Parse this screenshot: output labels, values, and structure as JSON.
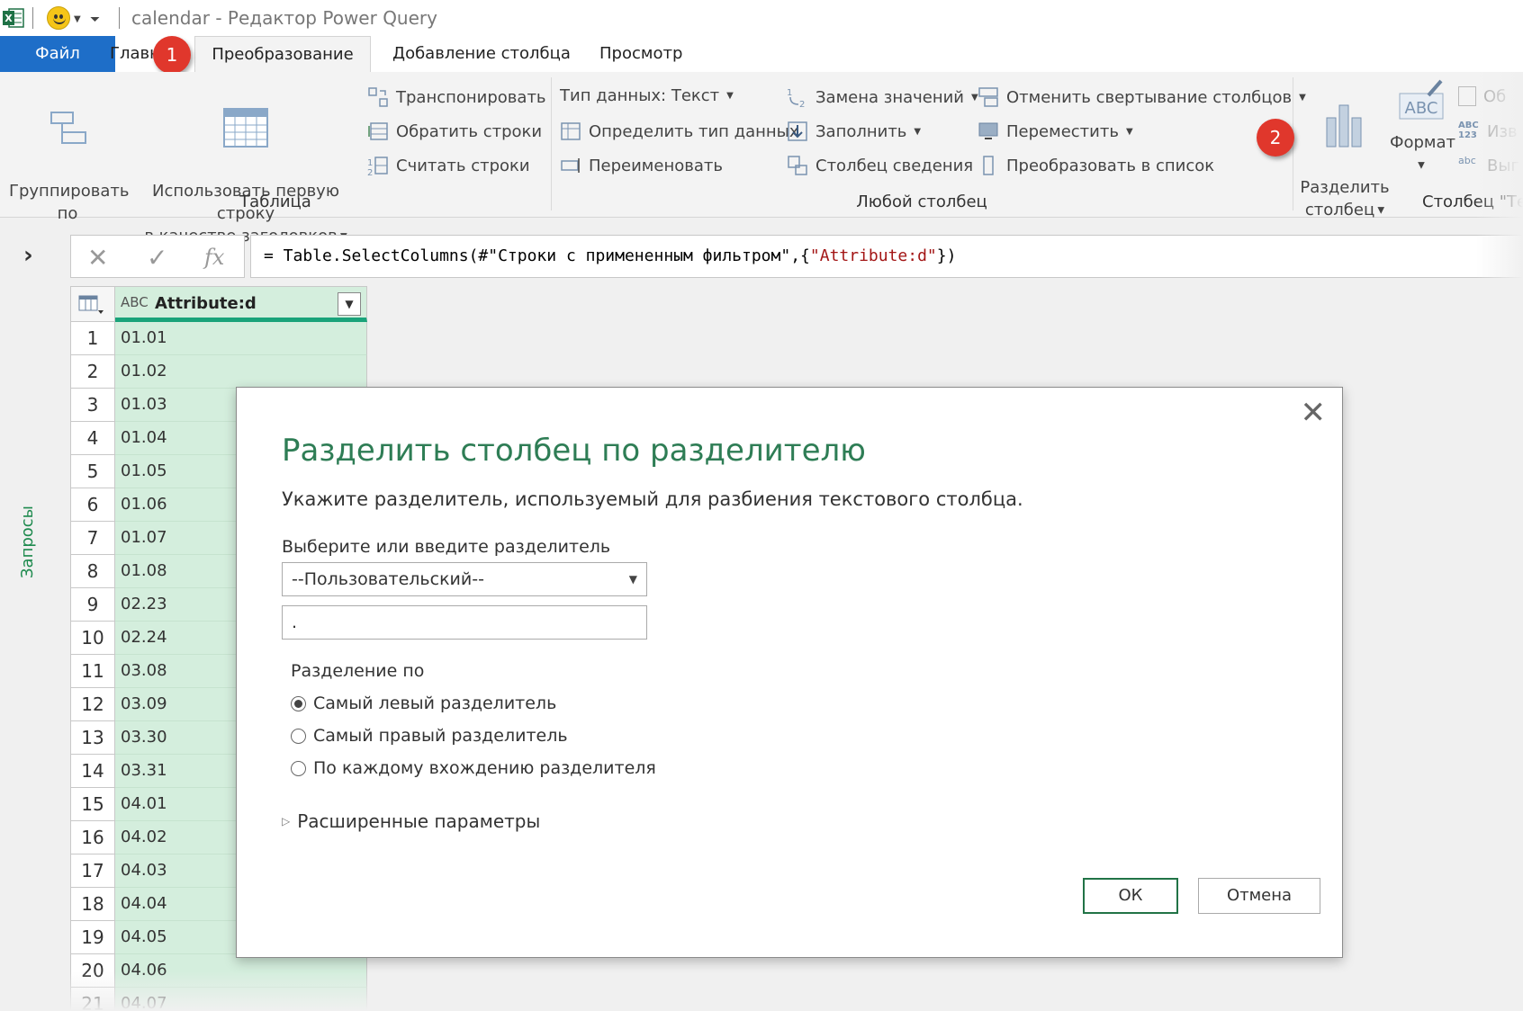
{
  "window": {
    "title": "calendar - Редактор Power Query"
  },
  "tabs": [
    {
      "label": "Файл"
    },
    {
      "label": "Главн"
    },
    {
      "label": "Преобразование"
    },
    {
      "label": "Добавление столбца"
    },
    {
      "label": "Просмотр"
    }
  ],
  "badges": [
    "1",
    "2"
  ],
  "ribbon": {
    "group_by": "Группировать\nпо",
    "use_first_row": "Использовать первую строку\nв качестве заголовков",
    "transpose": "Транспонировать",
    "reverse_rows": "Обратить строки",
    "count_rows": "Считать строки",
    "data_type": "Тип данных: Текст",
    "detect_type": "Определить тип данных",
    "rename": "Переименовать",
    "replace_values": "Замена значений",
    "fill": "Заполнить",
    "pivot": "Столбец сведения",
    "unpivot": "Отменить свертывание столбцов",
    "move": "Переместить",
    "to_list": "Преобразовать в список",
    "split_column": "Разделить\nстолбец",
    "format": "Формат",
    "merge_partial": "Об",
    "extract_partial": "Изв",
    "parse_partial": "Выг",
    "groups": {
      "table": "Таблица",
      "any_column": "Любой столбец",
      "text_column": "Столбец \"Те"
    }
  },
  "queries_pane": {
    "label": "Запросы"
  },
  "formula": {
    "prefix": "= Table.SelectColumns(#",
    "source": "\"Строки с примененным фильтром\"",
    "mid": ",{",
    "column": "\"Attribute:d\"",
    "suffix": "})"
  },
  "grid": {
    "column_type": "ABC",
    "column_name": "Attribute:d",
    "rows": [
      {
        "n": "1",
        "v": "01.01"
      },
      {
        "n": "2",
        "v": "01.02"
      },
      {
        "n": "3",
        "v": "01.03"
      },
      {
        "n": "4",
        "v": "01.04"
      },
      {
        "n": "5",
        "v": "01.05"
      },
      {
        "n": "6",
        "v": "01.06"
      },
      {
        "n": "7",
        "v": "01.07"
      },
      {
        "n": "8",
        "v": "01.08"
      },
      {
        "n": "9",
        "v": "02.23"
      },
      {
        "n": "10",
        "v": "02.24"
      },
      {
        "n": "11",
        "v": "03.08"
      },
      {
        "n": "12",
        "v": "03.09"
      },
      {
        "n": "13",
        "v": "03.30"
      },
      {
        "n": "14",
        "v": "03.31"
      },
      {
        "n": "15",
        "v": "04.01"
      },
      {
        "n": "16",
        "v": "04.02"
      },
      {
        "n": "17",
        "v": "04.03"
      },
      {
        "n": "18",
        "v": "04.04"
      },
      {
        "n": "19",
        "v": "04.05"
      },
      {
        "n": "20",
        "v": "04.06"
      },
      {
        "n": "21",
        "v": "04.07"
      }
    ]
  },
  "dialog": {
    "title": "Разделить столбец по разделителю",
    "subtitle": "Укажите разделитель, используемый для разбиения текстового столбца.",
    "delimiter_label": "Выберите или введите разделитель",
    "delimiter_value": "--Пользовательский--",
    "custom_value": ".",
    "split_at_label": "Разделение по",
    "options": [
      {
        "label": "Самый левый разделитель",
        "selected": true
      },
      {
        "label": "Самый правый разделитель",
        "selected": false
      },
      {
        "label": "По каждому вхождению разделителя",
        "selected": false
      }
    ],
    "advanced": "Расширенные параметры",
    "ok": "ОК",
    "cancel": "Отмена"
  },
  "colors": {
    "accent_green": "#217346",
    "file_tab_blue": "#1e6ec8",
    "badge_red": "#e0372c",
    "column_green": "#d4eedd"
  }
}
